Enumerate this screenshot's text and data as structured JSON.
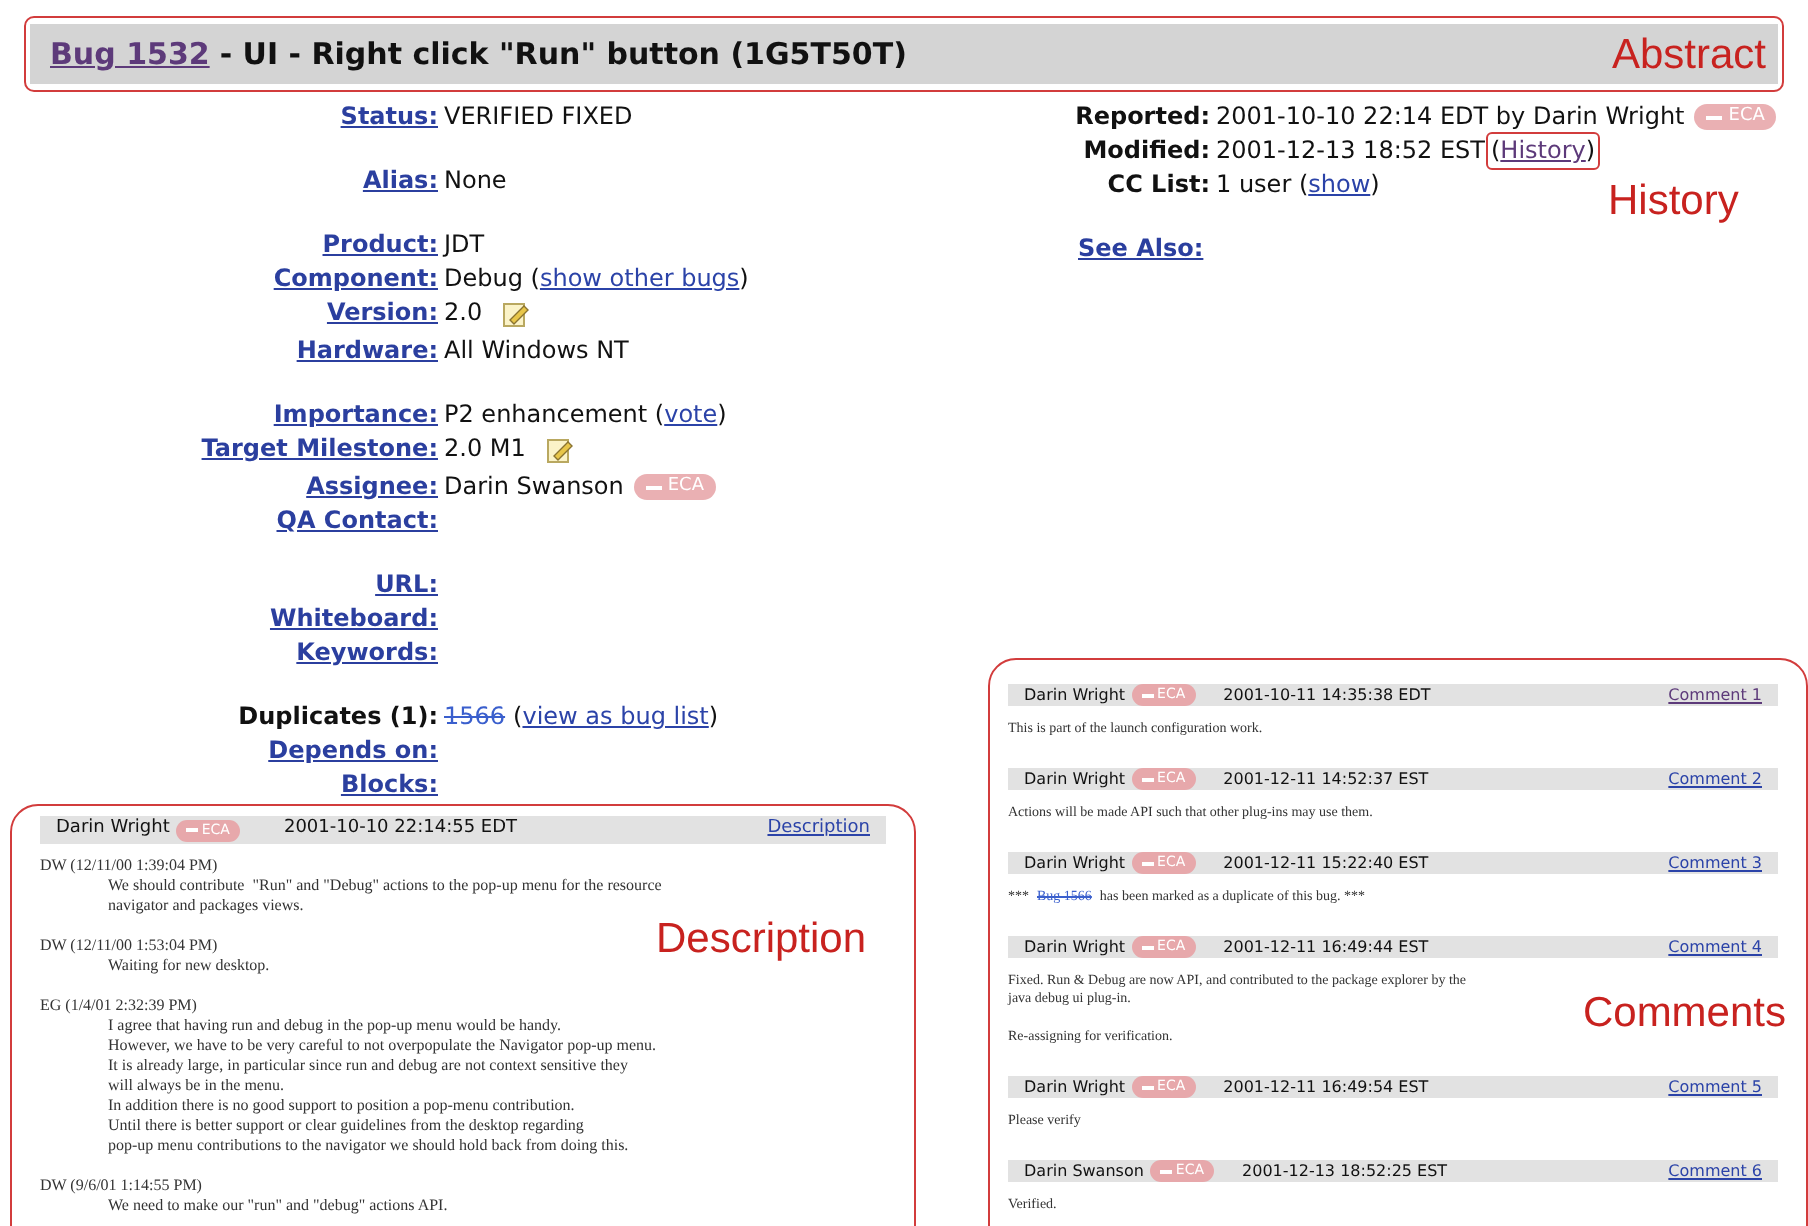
{
  "title": {
    "bug_link": "Bug 1532",
    "summary": "- UI - Right click \"Run\" button (1G5T50T)"
  },
  "field_groups": [
    [
      {
        "label": "Status:",
        "label_link": true,
        "parts": [
          {
            "text": "VERIFIED FIXED"
          }
        ]
      }
    ],
    [
      {
        "label": "Alias:",
        "label_link": true,
        "parts": [
          {
            "text": "None"
          }
        ]
      }
    ],
    [
      {
        "label": "Product:",
        "label_link": true,
        "parts": [
          {
            "text": "JDT"
          }
        ]
      },
      {
        "label": "Component:",
        "label_link": true,
        "parts": [
          {
            "text": "Debug ("
          },
          {
            "kind": "link",
            "text": "show other bugs"
          },
          {
            "text": ")"
          }
        ]
      },
      {
        "label": "Version:",
        "label_link": true,
        "parts": [
          {
            "text": "2.0"
          },
          {
            "kind": "edit"
          }
        ]
      },
      {
        "label": "Hardware:",
        "label_link": true,
        "parts": [
          {
            "text": "All Windows NT"
          }
        ]
      }
    ],
    [
      {
        "label": "Importance:",
        "label_link": true,
        "parts": [
          {
            "text": "P2 enhancement ("
          },
          {
            "kind": "link",
            "text": "vote"
          },
          {
            "text": ")"
          }
        ]
      },
      {
        "label": "Target Milestone:",
        "label_link": true,
        "parts": [
          {
            "text": "2.0 M1"
          },
          {
            "kind": "edit"
          }
        ]
      },
      {
        "label": "Assignee:",
        "label_link": true,
        "parts": [
          {
            "text": "Darin Swanson"
          },
          {
            "kind": "badge",
            "text": "ECA"
          }
        ]
      },
      {
        "label": "QA Contact:",
        "label_link": true
      }
    ],
    [
      {
        "label": "URL:",
        "label_link": true
      },
      {
        "label": "Whiteboard:",
        "label_link": true
      },
      {
        "label": "Keywords:",
        "label_link": true
      }
    ],
    [
      {
        "label": "Duplicates (1):",
        "label_link": false,
        "parts": [
          {
            "kind": "struck_link",
            "text": "1566"
          },
          {
            "text": "("
          },
          {
            "kind": "link",
            "text": "view as bug list"
          },
          {
            "text": ")"
          }
        ]
      },
      {
        "label": "Depends on:",
        "label_link": true
      },
      {
        "label": "Blocks:",
        "label_link": true
      }
    ]
  ],
  "meta": [
    {
      "label": "Reported:",
      "label_link": false,
      "parts": [
        {
          "text": "2001-10-10 22:14 EDT by Darin Wright"
        },
        {
          "kind": "badge",
          "text": "ECA"
        }
      ]
    },
    {
      "label": "Modified:",
      "label_link": false,
      "parts": [
        {
          "text": "2001-12-13 18:52 EST"
        },
        {
          "kind": "framed",
          "parts": [
            {
              "text": "("
            },
            {
              "kind": "link",
              "text": "History",
              "visited": true
            },
            {
              "text": ")"
            }
          ]
        }
      ]
    },
    {
      "label": "CC List:",
      "label_link": false,
      "parts": [
        {
          "text": "1 user ("
        },
        {
          "kind": "link",
          "text": "show"
        },
        {
          "text": ")"
        }
      ]
    }
  ],
  "see_also": {
    "label": "See Also:"
  },
  "description": {
    "author": "Darin Wright",
    "badge": "ECA",
    "time": "2001-10-10 22:14:55 EDT",
    "link": "Description",
    "entries": [
      {
        "header": "DW (12/11/00 1:39:04 PM)",
        "text": "We should contribute  \"Run\" and \"Debug\" actions to the pop-up menu for the resource\nnavigator and packages views."
      },
      {
        "header": "DW (12/11/00 1:53:04 PM)",
        "text": "Waiting for new desktop."
      },
      {
        "header": "EG (1/4/01 2:32:39 PM)",
        "text": "I agree that having run and debug in the pop-up menu would be handy.\nHowever, we have to be very careful to not overpopulate the Navigator pop-up menu.\nIt is already large, in particular since run and debug are not context sensitive they\nwill always be in the menu.\nIn addition there is no good support to position a pop-menu contribution.\nUntil there is better support or clear guidelines from the desktop regarding\npop-up menu contributions to the navigator we should hold back from doing this."
      },
      {
        "header": "DW (9/6/01 1:14:55 PM)",
        "text": "We need to make our \"run\" and \"debug\" actions API."
      }
    ]
  },
  "comments": [
    {
      "author": "Darin Wright",
      "badge": "ECA",
      "time": "2001-10-11 14:35:38 EDT",
      "link": "Comment 1",
      "visited": true,
      "paragraphs": [
        "This is part of the launch configuration work."
      ]
    },
    {
      "author": "Darin Wright",
      "badge": "ECA",
      "time": "2001-12-11 14:52:37 EST",
      "link": "Comment 2",
      "visited": false,
      "paragraphs": [
        "Actions will be made API such that other plug-ins may use them."
      ]
    },
    {
      "author": "Darin Wright",
      "badge": "ECA",
      "time": "2001-12-11 15:22:40 EST",
      "link": "Comment 3",
      "visited": false,
      "paragraphs": [
        [
          {
            "text": "***"
          },
          {
            "kind": "struck_link",
            "text": "Bug 1566"
          },
          {
            "text": "has been marked as a duplicate of this bug. ***"
          }
        ]
      ]
    },
    {
      "author": "Darin Wright",
      "badge": "ECA",
      "time": "2001-12-11 16:49:44 EST",
      "link": "Comment 4",
      "visited": false,
      "paragraphs": [
        "Fixed. Run & Debug are now API, and contributed to the package explorer by the\njava debug ui plug-in.",
        "Re-assigning for verification."
      ]
    },
    {
      "author": "Darin Wright",
      "badge": "ECA",
      "time": "2001-12-11 16:49:54 EST",
      "link": "Comment 5",
      "visited": false,
      "paragraphs": [
        "Please verify"
      ]
    },
    {
      "author": "Darin Swanson",
      "badge": "ECA",
      "time": "2001-12-13 18:52:25 EST",
      "link": "Comment 6",
      "visited": false,
      "paragraphs": [
        "Verified."
      ]
    }
  ],
  "annotations": [
    "Abstract",
    "History",
    "Description",
    "Comments"
  ]
}
